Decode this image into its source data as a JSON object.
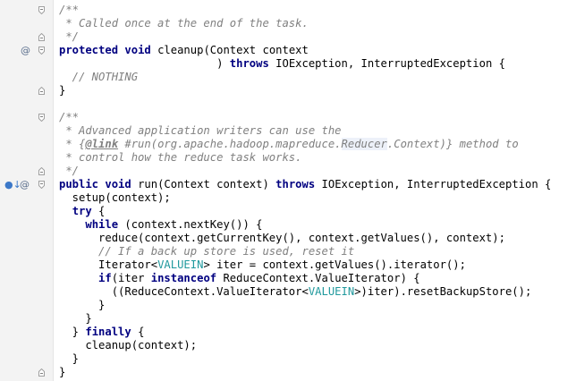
{
  "editor": {
    "lines": [
      {
        "fold": "top",
        "tokens": [
          {
            "t": "/**",
            "c": "cm"
          }
        ]
      },
      {
        "tokens": [
          {
            "t": " * Called once at the end of the task.",
            "c": "cm"
          }
        ]
      },
      {
        "fold": "bottom",
        "tokens": [
          {
            "t": " */",
            "c": "cm"
          }
        ]
      },
      {
        "gutter": "at",
        "fold": "top",
        "tokens": [
          {
            "t": "protected",
            "c": "kw"
          },
          {
            "t": " "
          },
          {
            "t": "void",
            "c": "kw"
          },
          {
            "t": " cleanup(Context context"
          }
        ]
      },
      {
        "tokens": [
          {
            "t": "                        ) "
          },
          {
            "t": "throws",
            "c": "kw"
          },
          {
            "t": " IOException, InterruptedException {"
          }
        ]
      },
      {
        "tokens": [
          {
            "t": "  // NOTHING",
            "c": "cm"
          }
        ]
      },
      {
        "fold": "bottom",
        "tokens": [
          {
            "t": "}"
          }
        ]
      },
      {
        "tokens": []
      },
      {
        "fold": "top",
        "tokens": [
          {
            "t": "/**",
            "c": "cm"
          }
        ]
      },
      {
        "tokens": [
          {
            "t": " * Advanced application writers can use the",
            "c": "cm"
          }
        ]
      },
      {
        "tokens": [
          {
            "t": " * {",
            "c": "cm"
          },
          {
            "t": "@link",
            "c": "tag"
          },
          {
            "t": " #run(org.apache.hadoop.mapreduce.",
            "c": "cm"
          },
          {
            "t": "Reducer",
            "c": "cm hl"
          },
          {
            "t": ".Context)} method to",
            "c": "cm"
          }
        ]
      },
      {
        "tokens": [
          {
            "t": " * control how the reduce task works.",
            "c": "cm"
          }
        ]
      },
      {
        "fold": "bottom",
        "tokens": [
          {
            "t": " */",
            "c": "cm"
          }
        ]
      },
      {
        "gutter": "override-at",
        "fold": "top",
        "tokens": [
          {
            "t": "public",
            "c": "kw"
          },
          {
            "t": " "
          },
          {
            "t": "void",
            "c": "kw"
          },
          {
            "t": " run(Context context) "
          },
          {
            "t": "throws",
            "c": "kw"
          },
          {
            "t": " IOException, InterruptedException {"
          }
        ]
      },
      {
        "tokens": [
          {
            "t": "  setup(context);"
          }
        ]
      },
      {
        "tokens": [
          {
            "t": "  "
          },
          {
            "t": "try",
            "c": "kw"
          },
          {
            "t": " {"
          }
        ]
      },
      {
        "tokens": [
          {
            "t": "    "
          },
          {
            "t": "while",
            "c": "kw"
          },
          {
            "t": " (context.nextKey()) {"
          }
        ]
      },
      {
        "tokens": [
          {
            "t": "      reduce(context.getCurrentKey(), context.getValues(), context);"
          }
        ]
      },
      {
        "tokens": [
          {
            "t": "      // If a back up store is used, reset it",
            "c": "cm"
          }
        ]
      },
      {
        "tokens": [
          {
            "t": "      Iterator<"
          },
          {
            "t": "VALUEIN",
            "c": "tp"
          },
          {
            "t": "> iter = context.getValues().iterator();"
          }
        ]
      },
      {
        "tokens": [
          {
            "t": "      "
          },
          {
            "t": "if",
            "c": "kw"
          },
          {
            "t": "(iter "
          },
          {
            "t": "instanceof",
            "c": "kw"
          },
          {
            "t": " ReduceContext.ValueIterator) {"
          }
        ]
      },
      {
        "tokens": [
          {
            "t": "        ((ReduceContext.ValueIterator<"
          },
          {
            "t": "VALUEIN",
            "c": "tp"
          },
          {
            "t": ">)iter).resetBackupStore();"
          }
        ]
      },
      {
        "tokens": [
          {
            "t": "      }"
          }
        ]
      },
      {
        "tokens": [
          {
            "t": "    }"
          }
        ]
      },
      {
        "tokens": [
          {
            "t": "  } "
          },
          {
            "t": "finally",
            "c": "kw"
          },
          {
            "t": " {"
          }
        ]
      },
      {
        "tokens": [
          {
            "t": "    cleanup(context);"
          }
        ]
      },
      {
        "tokens": [
          {
            "t": "  }"
          }
        ]
      },
      {
        "fold": "bottom",
        "tokens": [
          {
            "t": "}"
          }
        ]
      }
    ],
    "gutter_icons": {
      "at": "@",
      "override": "●↓"
    },
    "colors": {
      "keyword": "#000080",
      "comment": "#808080",
      "type_param": "#20999d",
      "gutter_bg": "#f3f3f3",
      "highlight": "#edf1f9"
    }
  }
}
